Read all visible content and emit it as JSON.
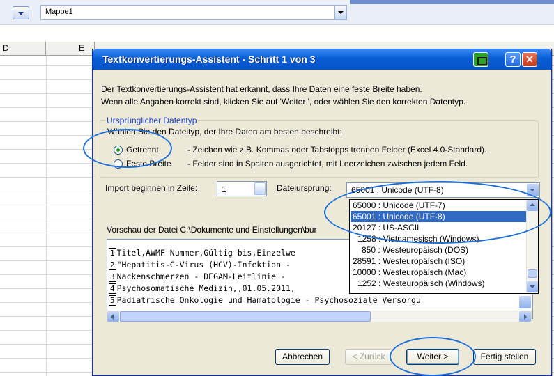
{
  "toolbar": {
    "workbook_name": "Mappe1"
  },
  "columns": [
    "D",
    "E"
  ],
  "dialog": {
    "title": "Textkonvertierungs-Assistent - Schritt 1 von 3",
    "intro_line1": "Der Textkonvertierungs-Assistent hat erkannt, dass Ihre Daten eine feste Breite haben.",
    "intro_line2": "Wenn alle Angaben korrekt sind, klicken Sie auf 'Weiter ', oder wählen Sie den korrekten Datentyp.",
    "group_label": "Ursprünglicher Datentyp",
    "group_prompt": "Wählen Sie den Dateityp, der Ihre Daten am besten beschreibt:",
    "radio_delimited": "Getrennt",
    "radio_delimited_desc": "- Zeichen wie z.B. Kommas oder Tabstopps trennen Felder (Excel 4.0-Standard).",
    "radio_fixed": "Feste Breite",
    "radio_fixed_desc": "- Felder sind in Spalten ausgerichtet, mit Leerzeichen zwischen jedem Feld.",
    "import_label": "Import beginnen in Zeile:",
    "import_value": "1",
    "origin_label": "Dateiursprung:",
    "origin_value": "65001 : Unicode (UTF-8)",
    "origin_options": [
      "65000 : Unicode (UTF-7)",
      "65001 : Unicode (UTF-8)",
      "20127 : US-ASCII",
      "1258 : Vietnamesisch (Windows)",
      "850 : Westeuropäisch (DOS)",
      "28591 : Westeuropäisch (ISO)",
      "10000 : Westeuropäisch (Mac)",
      "1252 : Westeuropäisch (Windows)"
    ],
    "preview_label": "Vorschau der Datei C:\\Dokumente und Einstellungen\\bur",
    "preview_lines": [
      {
        "n": "1",
        "text": "Titel,AWMF Nummer,Gültig bis,Einzelwe"
      },
      {
        "n": "2",
        "text": "\"Hepatitis-C-Virus (HCV)-Infektion - "
      },
      {
        "n": "3",
        "text": "Nackenschmerzen - DEGAM-Leitlinie - "
      },
      {
        "n": "4",
        "text": "Psychosomatische Medizin,,01.05.2011,"
      },
      {
        "n": "5",
        "text": "Pädiatrische Onkologie und Hämatologie - Psychosoziale Versorgu"
      }
    ],
    "buttons": {
      "cancel": "Abbrechen",
      "back": "< Zurück",
      "next": "Weiter >",
      "finish": "Fertig stellen"
    }
  }
}
